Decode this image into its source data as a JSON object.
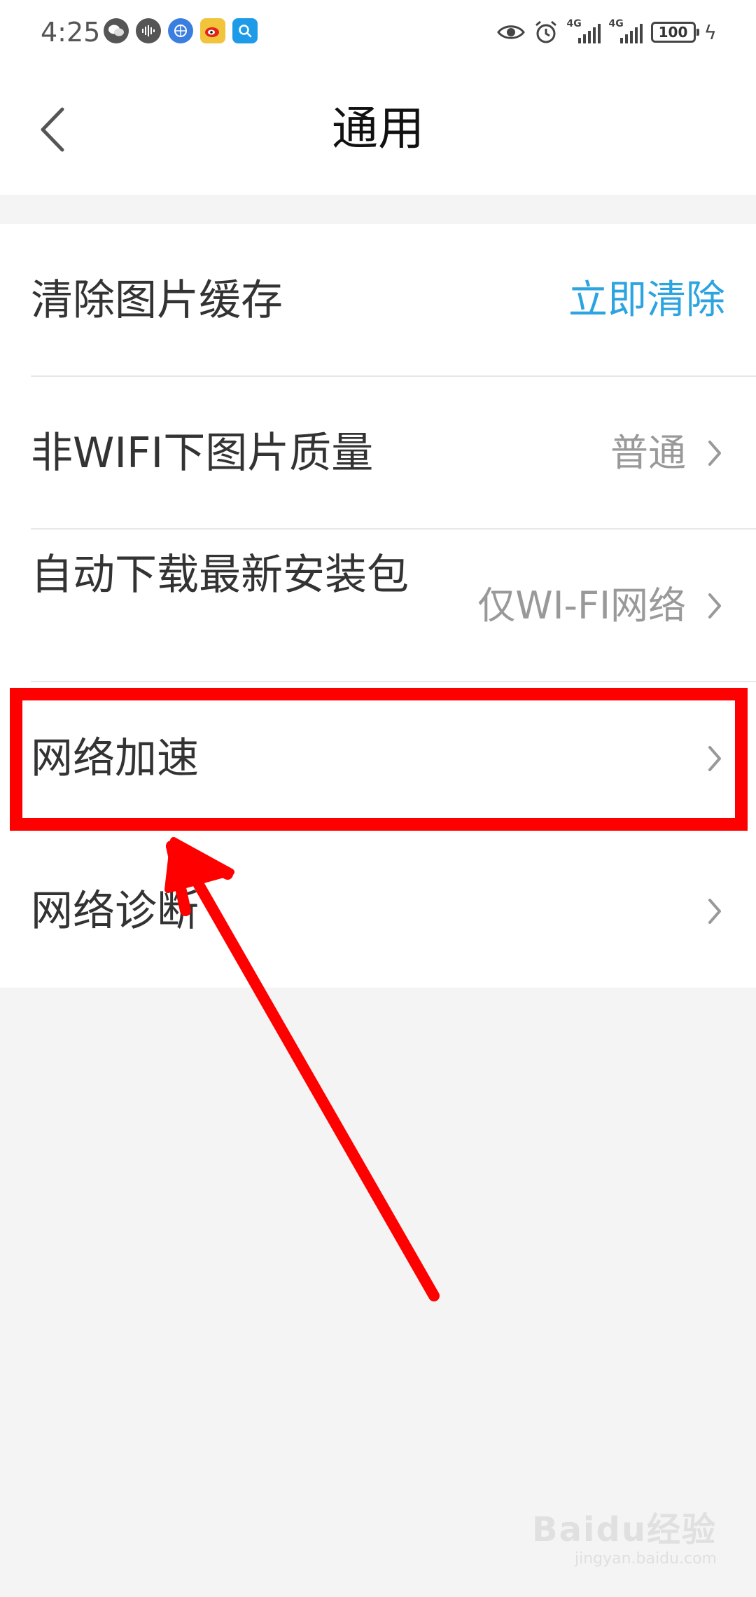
{
  "status_bar": {
    "time": "4:25",
    "left_icons": [
      "wechat-icon",
      "voice-assistant-icon",
      "browser-icon",
      "weibo-icon",
      "search-app-icon"
    ],
    "right_icons": [
      "eye-icon",
      "alarm-icon",
      "signal-4g-icon",
      "signal-4g-icon",
      "battery-icon",
      "charging-icon"
    ],
    "network_label": "4G",
    "battery_level": "100"
  },
  "header": {
    "title": "通用",
    "back_icon": "chevron-left-icon"
  },
  "settings": {
    "items": [
      {
        "label": "清除图片缓存",
        "action": "立即清除"
      },
      {
        "label": "非WIFI下图片质量",
        "value": "普通"
      },
      {
        "label": "自动下载最新安装包",
        "value": "仅WI-FI网络"
      },
      {
        "label": "网络加速"
      },
      {
        "label": "网络诊断"
      }
    ]
  },
  "annotation": {
    "highlight_color": "#ff0000",
    "arrow_color": "#ff0000",
    "highlighted_item": "网络加速"
  },
  "watermark": {
    "main": "Baidu经验",
    "sub": "jingyan.baidu.com"
  },
  "colors": {
    "accent": "#2ba4e0",
    "background": "#f4f4f4",
    "card": "#ffffff",
    "secondary_text": "#999999"
  }
}
